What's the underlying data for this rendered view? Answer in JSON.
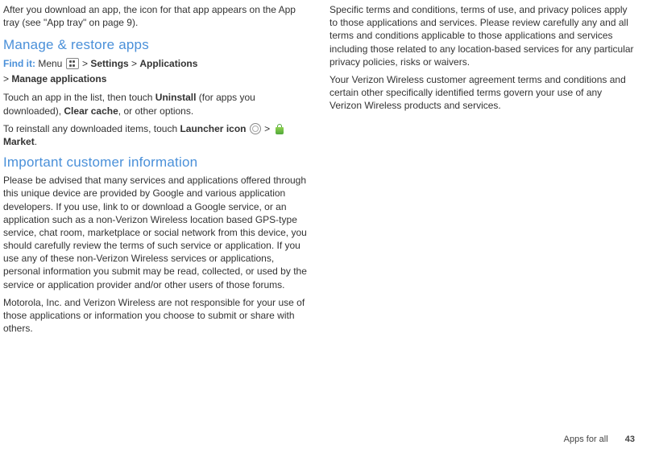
{
  "col1": {
    "intro": "After you download an app, the icon for that app appears on the App tray (see \"App tray\" on page 9).",
    "manage": {
      "heading": "Manage & restore apps",
      "findit_label": "Find it:",
      "findit_prefix": " Menu ",
      "findit_icon": "menu-grid-icon",
      "findit_sep1": " > ",
      "findit_settings": "Settings",
      "findit_sep2": " > ",
      "findit_apps": "Applications",
      "findit_sep3": "> ",
      "findit_manage": "Manage applications",
      "p2a": "Touch an app in the list, then touch ",
      "p2b": "Uninstall",
      "p2c": " (for apps you downloaded), ",
      "p2d": "Clear cache",
      "p2e": ", or other options.",
      "p3a": "To reinstall any downloaded items, touch ",
      "p3b": "Launcher icon",
      "p3c": "  >  ",
      "p3d": "Market",
      "p3e": "."
    },
    "important": {
      "heading": "Important customer information",
      "p1": "Please be advised that many services and applications offered through this unique device are provided by Google and various application developers. If you use, link to or download a Google service, or an application such as a non-Verizon Wireless location based GPS-type service, chat room, marketplace or social network from this device, you should carefully review the terms of such service or application. If you use any of these non-Verizon Wireless services or applications, personal information you submit may be read, collected, or used by the service or application provider and/or other users of those forums.",
      "p2": "Motorola, Inc. and Verizon Wireless are not responsible for your use of those applications or information you choose to submit or share with others."
    }
  },
  "col2": {
    "p1": "Specific terms and conditions, terms of use, and privacy polices apply to those applications and services. Please review carefully any and all terms and conditions applicable to those applications and services including those related to any location-based services for any particular privacy policies, risks or waivers.",
    "p2": "Your Verizon Wireless customer agreement terms and conditions and certain other specifically identified terms govern your use of any Verizon Wireless products and services."
  },
  "footer": {
    "section": "Apps for all",
    "page": "43"
  }
}
